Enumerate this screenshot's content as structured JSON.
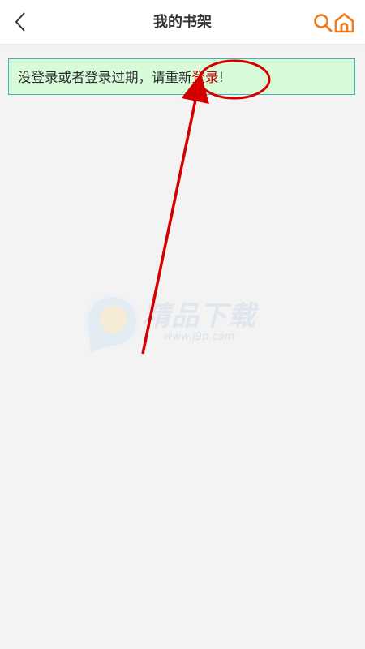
{
  "header": {
    "title": "我的书架",
    "back_icon": "chevron-left-icon",
    "search_icon": "search-icon",
    "home_icon": "home-icon",
    "accent_color": "#f07a1a"
  },
  "notice": {
    "text_before": "没登录或者登录过期，请重新",
    "link_label": "登录",
    "text_after": "!",
    "background": "#d7fbd9",
    "border_color": "#41b6b0",
    "link_color": "#c40000"
  },
  "watermark": {
    "text": "精品下载",
    "url": "www.j9p.com"
  },
  "annotation": {
    "color": "#d40000"
  }
}
